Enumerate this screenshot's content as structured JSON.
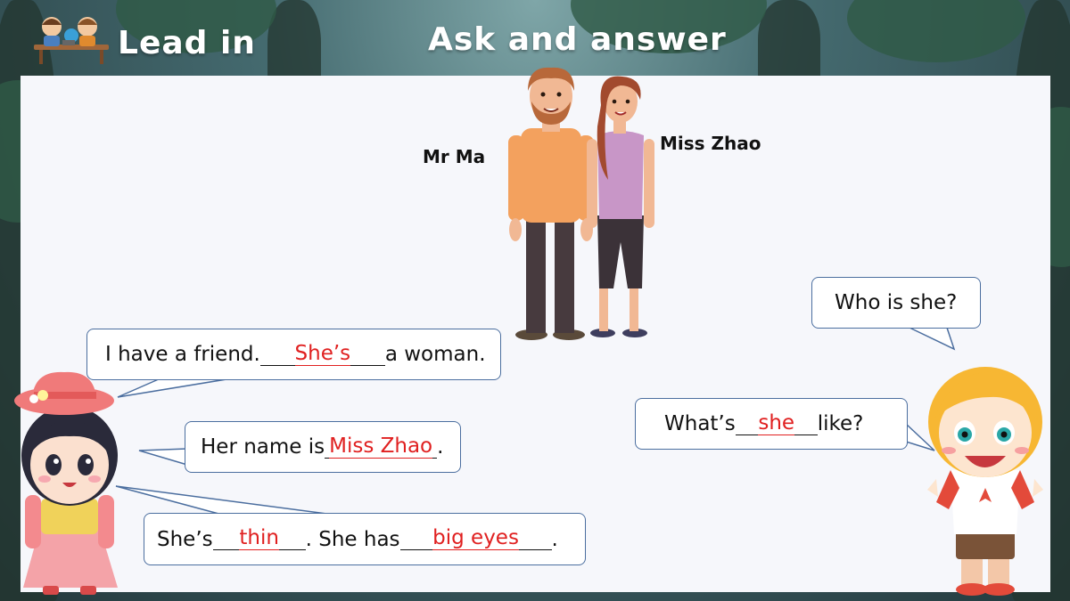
{
  "header": {
    "section_title": "Lead in",
    "activity_title": "Ask and answer"
  },
  "people": {
    "man_name": "Mr Ma",
    "woman_name": "Miss Zhao"
  },
  "boy_bubbles": {
    "question1": "Who is she?",
    "question2": {
      "before": "What’s ",
      "answer": "she",
      "after": " like?"
    }
  },
  "girl_bubbles": {
    "line1": {
      "before": "I have a friend.",
      "answer": "She’s",
      "after": "a woman."
    },
    "line2": {
      "before": "Her name is ",
      "answer": "Miss Zhao",
      "after": "."
    },
    "line3": {
      "before": "She’s ",
      "answer1": "thin",
      "middle": ". She has ",
      "answer2": "big eyes",
      "after": "."
    }
  },
  "colors": {
    "answer": "#e02020",
    "bubble_border": "#4b6e9f",
    "panel": "#f6f7fb"
  }
}
